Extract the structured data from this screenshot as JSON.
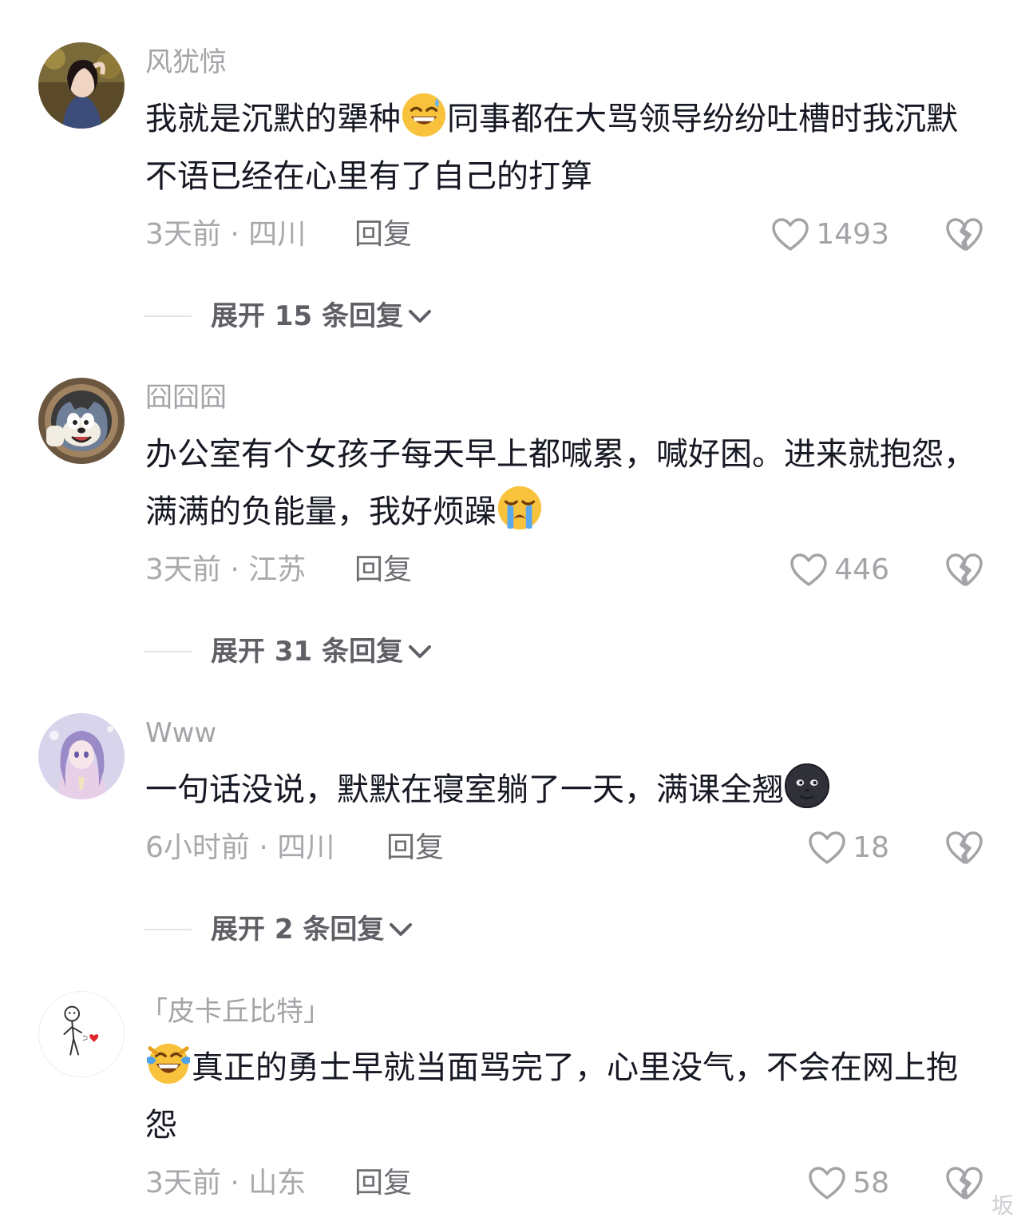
{
  "comments": [
    {
      "username": "风犹惊",
      "text_before": "我就是沉默的犟种",
      "emoji_mid": "grinning-sweat-emoji",
      "text_after": "同事都在大骂领导纷纷吐槽时我沉默不语已经在心里有了自己的打算",
      "time_location": "3天前 · 四川",
      "reply_label": "回复",
      "like_count": "1493",
      "expand_label": "展开 15 条回复"
    },
    {
      "username": "囧囧囧",
      "text_before": "办公室有个女孩子每天早上都喊累，喊好困。进来就抱怨，满满的负能量，我好烦躁",
      "emoji_end": "loudly-crying-emoji",
      "time_location": "3天前 · 江苏",
      "reply_label": "回复",
      "like_count": "446",
      "expand_label": "展开 31 条回复"
    },
    {
      "username": "Www",
      "text_before": "一句话没说，默默在寝室躺了一天，满课全翘",
      "emoji_end": "new-moon-face-emoji",
      "time_location": "6小时前 · 四川",
      "reply_label": "回复",
      "like_count": "18",
      "expand_label": "展开 2 条回复"
    },
    {
      "username": "「皮卡丘比特」",
      "emoji_start": "tears-of-joy-emoji",
      "text_after": "真正的勇士早就当面骂完了，心里没气，不会在网上抱怨",
      "time_location": "3天前 · 山东",
      "reply_label": "回复",
      "like_count": "58"
    }
  ],
  "watermark": "坂",
  "colors": {
    "username": "#a3a3a8",
    "content": "#161823",
    "meta": "#a8a8ad",
    "expand": "#5f5f66"
  }
}
